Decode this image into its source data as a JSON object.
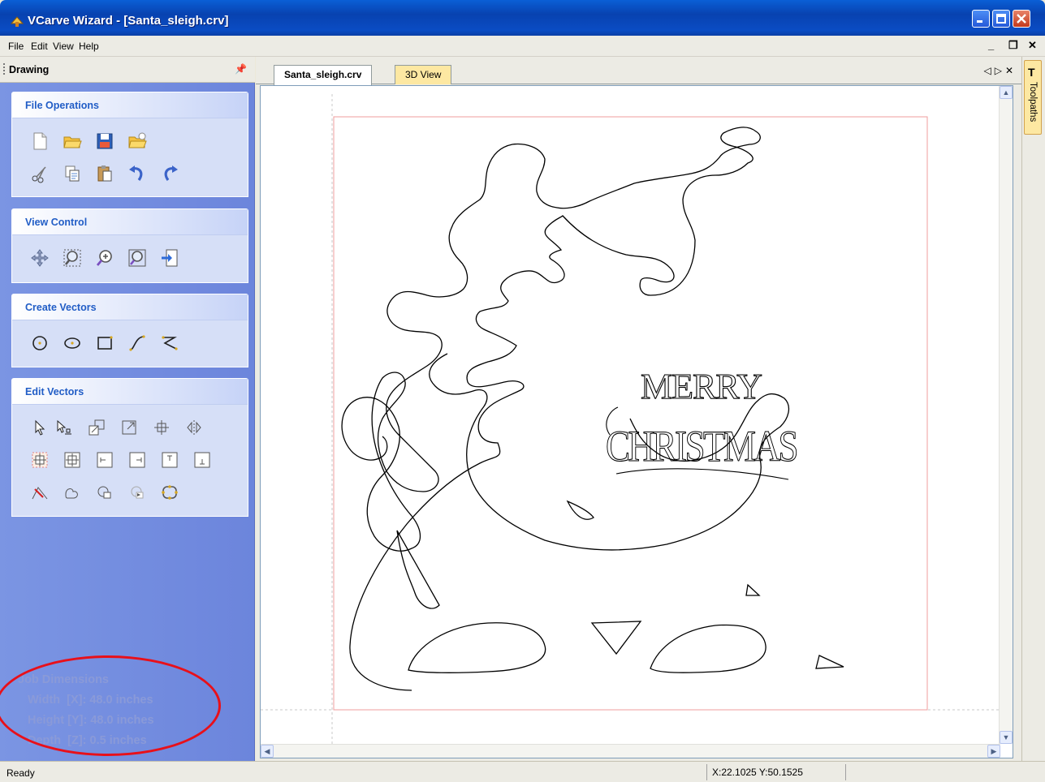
{
  "window": {
    "title": "VCarve Wizard - [Santa_sleigh.crv]"
  },
  "menu": {
    "items": [
      "File",
      "Edit",
      "View",
      "Help"
    ],
    "mdi_controls": [
      "_",
      "Δ",
      "✕"
    ]
  },
  "panel": {
    "title": "Drawing",
    "pin": "4"
  },
  "groups": {
    "file_operations": {
      "title": "File Operations"
    },
    "view_control": {
      "title": "View Control"
    },
    "create_vectors": {
      "title": "Create Vectors"
    },
    "edit_vectors": {
      "title": "Edit Vectors"
    }
  },
  "job_dimensions": {
    "title": "Job Dimensions",
    "width": "Width  [X]: 48.0 inches",
    "height": "Height [Y]: 48.0 inches",
    "depth": "Depth  [Z]: 0.5 inches"
  },
  "tabs": {
    "active": "Santa_sleigh.crv",
    "inactive": "3D View",
    "nav": "◁▷✕"
  },
  "canvas": {
    "artwork_text": [
      "MERRY",
      "CHRISTMAS"
    ]
  },
  "right_panel": {
    "toolpaths_label": "Toolpaths"
  },
  "status": {
    "text": "Ready",
    "coords": "X:22.1025 Y:50.1525"
  },
  "colors": {
    "title_bar": "#0842b0",
    "panel_bg": "#7b95e3",
    "group_title": "#215dc6",
    "annotation": "#e8101a"
  },
  "icons": {
    "file_operations": [
      "new-file-icon",
      "open-folder-icon",
      "save-icon",
      "open-recent-icon",
      "cut-icon",
      "copy-icon",
      "paste-icon",
      "undo-icon",
      "redo-icon"
    ],
    "view_control": [
      "pan-icon",
      "zoom-box-icon",
      "zoom-in-icon",
      "zoom-all-icon",
      "import-icon"
    ],
    "create_vectors": [
      "circle-icon",
      "ellipse-icon",
      "rectangle-icon",
      "curve-icon",
      "polyline-icon"
    ],
    "edit_vectors": [
      "select-icon",
      "node-edit-icon",
      "scale-icon",
      "resize-icon",
      "move-icon",
      "mirror-icon",
      "align-center-icon",
      "center-in-material-icon",
      "align-left-icon",
      "align-right-icon",
      "align-top-icon",
      "align-bottom-icon",
      "trim-icon",
      "weld-icon",
      "subtract-icon",
      "intersect-icon",
      "join-icon"
    ]
  }
}
